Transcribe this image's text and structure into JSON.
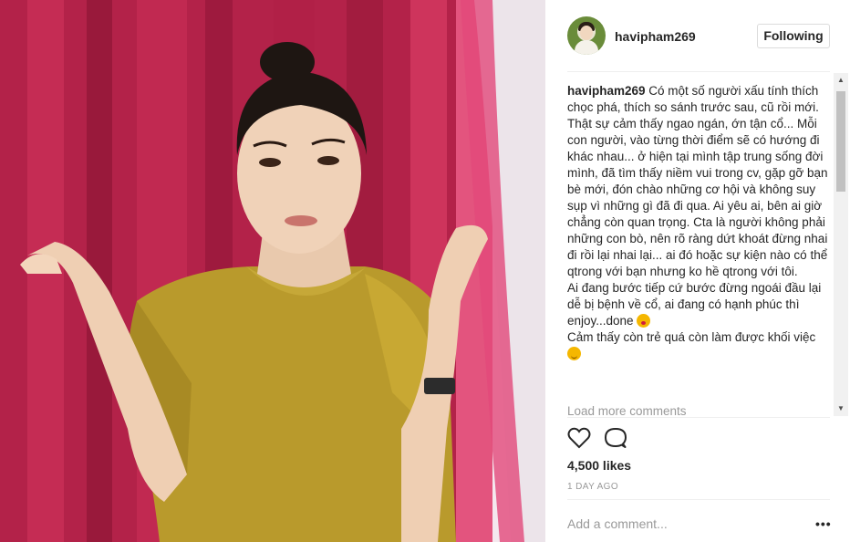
{
  "post": {
    "username": "havipham269",
    "follow_label": "Following",
    "caption_user": "havipham269",
    "caption_part1": " Có một số người xấu tính thích chọc phá, thích so sánh trước sau, cũ rồi mới. Thật sự cảm thấy ngao ngán, ớn tận cổ... Mỗi con người, vào từng thời điểm sẽ có hướng đi khác nhau... ở hiện tại mình tập trung sống đời mình, đã tìm thấy niềm vui trong cv, gặp gỡ bạn bè mới, đón chào những cơ hội và không suy sụp vì những gì đã đi qua. Ai yêu ai, bên ai giờ chẳng còn quan trọng. Cta là người không phải những con bò, nên rõ ràng dứt khoát đừng nhai đi rồi lại nhai lại... ai đó hoặc sự kiện nào có thể qtrong với bạn nhưng ko hề qtrong với tôi.\nAi đang bước tiếp cứ bước đừng ngoái đầu lại dễ bị bệnh về cổ, ai đang có hạnh phúc thì enjoy...done ",
    "caption_part2": "\nCảm thấy còn trẻ quá còn làm được khối việc ",
    "load_more": "Load more comments",
    "likes": "4,500 likes",
    "time": "1 DAY AGO",
    "add_comment_placeholder": "Add a comment...",
    "more_options": "•••"
  },
  "icons": {
    "heart": "heart-icon",
    "comment": "comment-icon",
    "emoji_kiss": "kissing-face-emoji",
    "emoji_smile": "smiling-face-emoji",
    "scroll_up": "▲",
    "scroll_down": "▼"
  },
  "colors": {
    "curtain": "#c42a52",
    "shirt": "#b99a2c",
    "text": "#262626",
    "muted": "#999999",
    "divider": "#efefef"
  }
}
